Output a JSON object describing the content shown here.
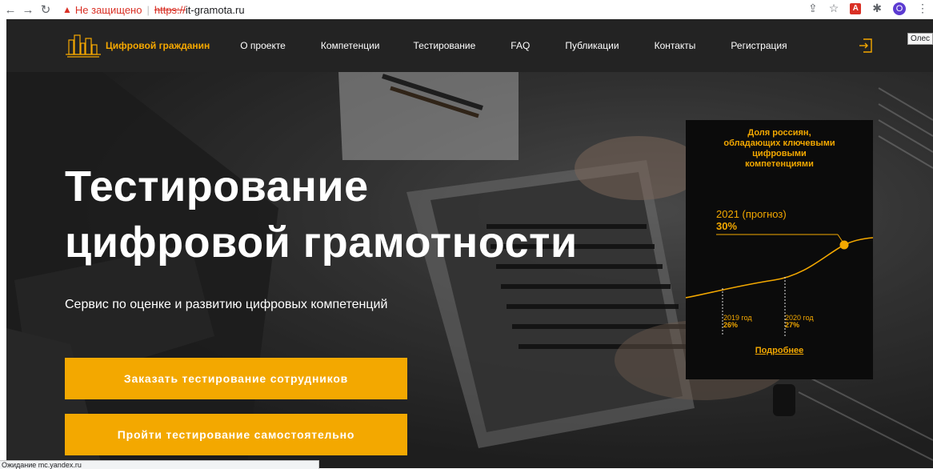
{
  "browser": {
    "security_label": "Не защищено",
    "url_scheme": "https://",
    "url_host": "it-gramota.ru",
    "profile_initial": "O",
    "tooltip": "Олес",
    "status_text": "Ожидание mc.yandex.ru",
    "icons": [
      "back-icon",
      "forward-icon",
      "reload-icon",
      "warning-icon",
      "share-icon",
      "star-icon",
      "pdf-icon",
      "extensions-icon",
      "menu-icon"
    ]
  },
  "header": {
    "logo_text": "Цифровой гражданин",
    "menu": [
      "О проекте",
      "Компетенции",
      "Тестирование",
      "FAQ",
      "Публикации",
      "Контакты",
      "Регистрация"
    ],
    "login_icon": "login-icon"
  },
  "hero": {
    "title_line1": "Тестирование",
    "title_line2": "цифровой грамотности",
    "subtitle": "Сервис по оценке и развитию цифровых компетенций",
    "button_order": "Заказать тестирование сотрудников",
    "button_self": "Пройти тестирование самостоятельно"
  },
  "card": {
    "title_lines": [
      "Доля россиян,",
      "обладающих ключевыми",
      "цифровыми",
      "компетенциями"
    ],
    "forecast_label": "2021 (прогноз)",
    "forecast_value": "30%",
    "points": [
      {
        "year": "2019 год",
        "value": "26%"
      },
      {
        "year": "2020 год",
        "value": "27%"
      }
    ],
    "more_link": "Подробнее"
  },
  "colors": {
    "accent": "#f3a800",
    "header_bg": "#232323",
    "card_bg": "#0b0b0b"
  }
}
